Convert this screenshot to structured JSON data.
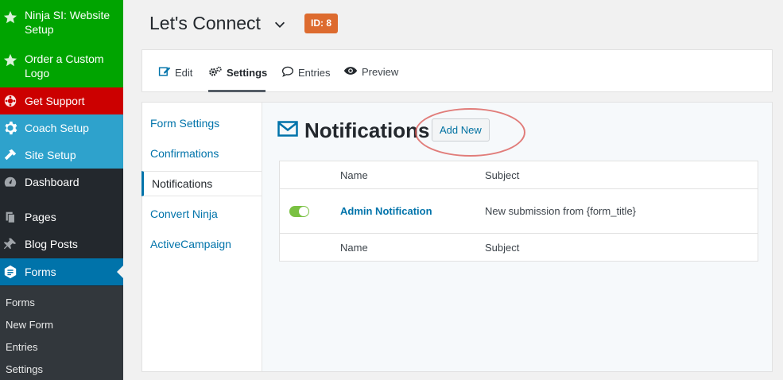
{
  "sidebar": {
    "items": [
      {
        "label": "Ninja SI: Website Setup",
        "icon": "star-icon"
      },
      {
        "label": "Order a Custom Logo",
        "icon": "star-icon"
      },
      {
        "label": "Get Support",
        "icon": "lifebuoy-icon"
      },
      {
        "label": "Coach Setup",
        "icon": "gear-icon"
      },
      {
        "label": "Site Setup",
        "icon": "hammer-icon"
      },
      {
        "label": "Dashboard",
        "icon": "dashboard-icon"
      },
      {
        "label": "Pages",
        "icon": "pages-icon"
      },
      {
        "label": "Blog Posts",
        "icon": "pin-icon"
      },
      {
        "label": "Forms",
        "icon": "forms-icon"
      }
    ],
    "submenu": [
      "Forms",
      "New Form",
      "Entries",
      "Settings"
    ]
  },
  "header": {
    "title": "Let's Connect",
    "id_badge": "ID: 8"
  },
  "tabs": [
    {
      "label": "Edit",
      "icon": "edit-icon"
    },
    {
      "label": "Settings",
      "icon": "gears-icon",
      "active": true
    },
    {
      "label": "Entries",
      "icon": "speech-bubble-icon"
    },
    {
      "label": "Preview",
      "icon": "eye-icon"
    }
  ],
  "settings_nav": [
    "Form Settings",
    "Confirmations",
    "Notifications",
    "Convert Ninja",
    "ActiveCampaign"
  ],
  "notifications": {
    "heading": "Notifications",
    "add_new_label": "Add New",
    "columns": [
      "Name",
      "Subject"
    ],
    "rows": [
      {
        "name": "Admin Notification",
        "subject": "New submission from {form_title}",
        "enabled": true
      }
    ]
  },
  "colors": {
    "accent": "#0073aa",
    "badge": "#dd6b2f",
    "toggle_on": "#7ac142",
    "sidebar_green": "#00a400",
    "sidebar_red": "#cc0000",
    "sidebar_blue": "#2ea2cc"
  }
}
